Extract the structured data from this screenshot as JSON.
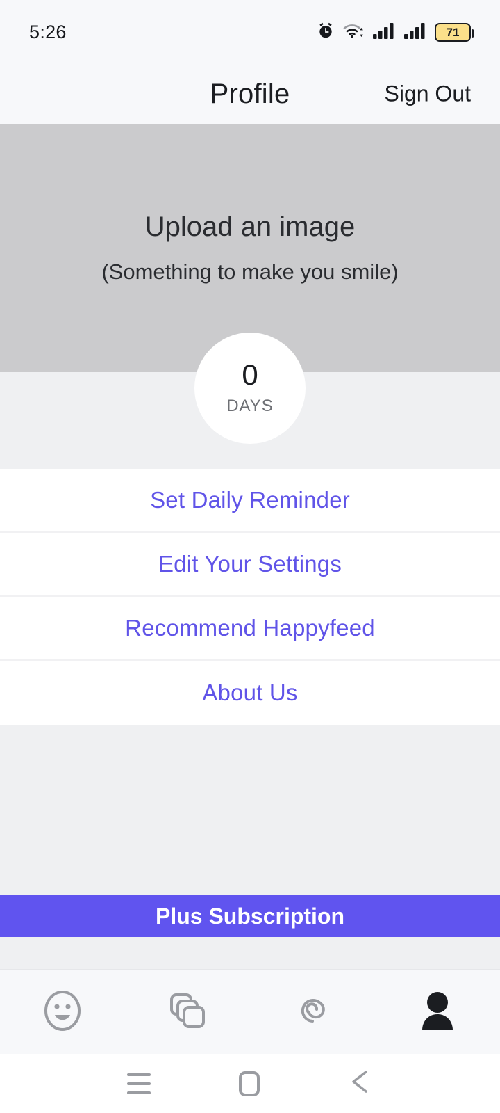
{
  "status_bar": {
    "time": "5:26",
    "battery_percent": "71",
    "icons": [
      "alarm-clock-icon",
      "wifi-icon",
      "signal-icon-1",
      "signal-icon-2",
      "battery-icon"
    ]
  },
  "header": {
    "title": "Profile",
    "sign_out_label": "Sign Out"
  },
  "hero": {
    "title": "Upload an image",
    "subtitle": "(Something to make you smile)"
  },
  "streak": {
    "count": "0",
    "unit": "DAYS"
  },
  "menu": {
    "items": [
      {
        "label": "Set Daily Reminder"
      },
      {
        "label": "Edit Your Settings"
      },
      {
        "label": "Recommend Happyfeed"
      },
      {
        "label": "About Us"
      }
    ]
  },
  "subscription": {
    "label": "Plus Subscription"
  },
  "tab_bar": {
    "tabs": [
      {
        "icon": "smiley-face-icon",
        "active": false
      },
      {
        "icon": "stacked-cards-icon",
        "active": false
      },
      {
        "icon": "spiral-icon",
        "active": false
      },
      {
        "icon": "person-icon",
        "active": true
      }
    ]
  },
  "android_nav": {
    "buttons": [
      "recents-icon",
      "home-icon",
      "back-icon"
    ]
  },
  "colors": {
    "accent_purple": "#6054e8",
    "subscription_purple": "#6054ef",
    "hero_grey": "#cbcbcd",
    "panel_grey": "#eff0f2",
    "chrome_grey": "#f7f8fa",
    "battery_yellow": "#fbe08a",
    "icon_grey": "#9a9ca1"
  }
}
